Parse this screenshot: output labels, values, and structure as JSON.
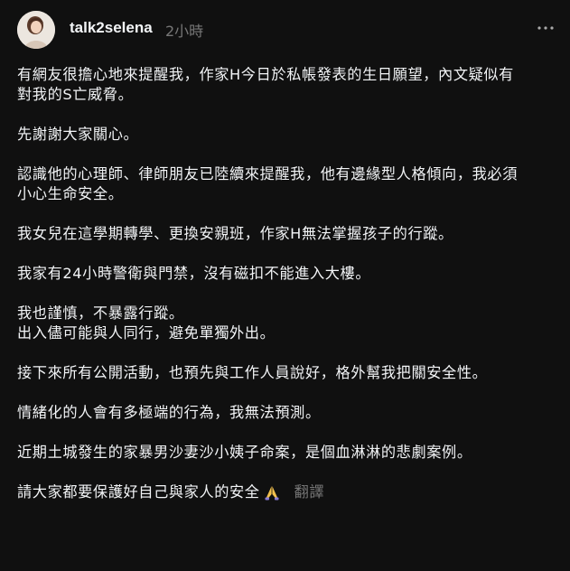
{
  "post": {
    "username": "talk2selena",
    "timestamp": "2小時",
    "more_icon": "more-horizontal-icon",
    "avatar_icon": "profile-photo",
    "paragraphs": [
      [
        "有網友很擔心地來提醒我，作家H今日於私帳發表的生日願望，內文疑似有",
        "對我的S亡威脅。"
      ],
      [
        "先謝謝大家關心。"
      ],
      [
        "認識他的心理師、律師朋友已陸續來提醒我，他有邊緣型人格傾向，我必須",
        "小心生命安全。"
      ],
      [
        "我女兒在這學期轉學、更換安親班，作家H無法掌握孩子的行蹤。"
      ],
      [
        "我家有24小時警衛與門禁，沒有磁扣不能進入大樓。"
      ],
      [
        "我也謹慎，不暴露行蹤。",
        "出入儘可能與人同行，避免單獨外出。"
      ],
      [
        "接下來所有公開活動，也預先與工作人員說好，格外幫我把關安全性。"
      ],
      [
        "情緒化的人會有多極端的行為，我無法預測。"
      ],
      [
        "近期土城發生的家暴男沙妻沙小姨子命案，是個血淋淋的悲劇案例。"
      ]
    ],
    "last_line": "請大家都要保護好自己與家人的安全",
    "emoji_icon": "praying-hands-icon",
    "translate_label": "翻譯"
  }
}
